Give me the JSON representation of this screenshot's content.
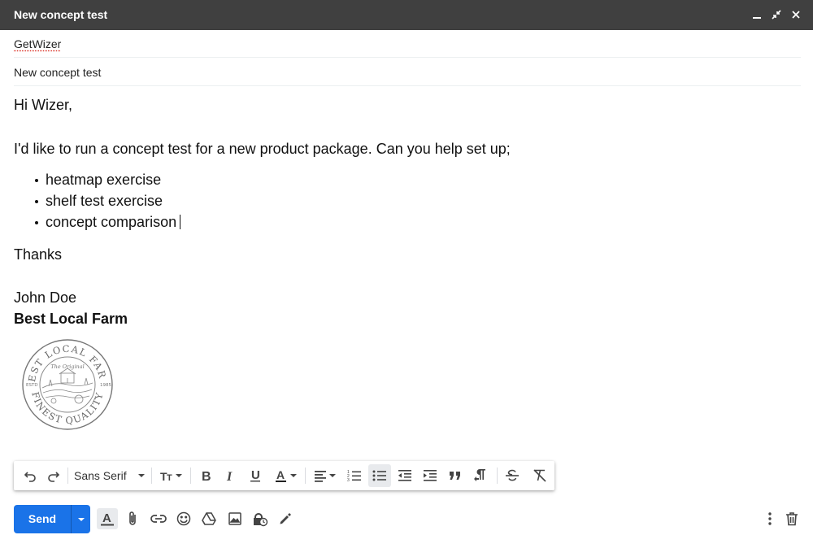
{
  "window": {
    "title": "New concept test",
    "controls": [
      "minimize-icon",
      "exit-fullscreen-icon",
      "close-icon"
    ]
  },
  "header": {
    "to": "GetWizer",
    "subject": "New concept test"
  },
  "message": {
    "greeting": "Hi Wizer,",
    "intro": "I'd like to run a concept test for a new product package. Can you help set up;",
    "items": [
      "heatmap exercise",
      "shelf test exercise",
      "concept comparison"
    ],
    "closing": "Thanks",
    "signature_name": "John Doe",
    "signature_company": "Best Local Farm",
    "logo": {
      "top_text": "BEST LOCAL FARM",
      "bottom_text": "FINEST QUALITY",
      "center_text": "The Original",
      "left_text": "ESTD",
      "right_text": "1985"
    }
  },
  "format_toolbar": {
    "font_family": "Sans Serif",
    "tools": [
      "undo-icon",
      "redo-icon",
      "font-size-icon",
      "bold-icon",
      "italic-icon",
      "underline-icon",
      "text-color-icon",
      "align-icon",
      "numbered-list-icon",
      "bulleted-list-icon",
      "indent-less-icon",
      "indent-more-icon",
      "quote-icon",
      "text-direction-icon",
      "strikethrough-icon",
      "remove-formatting-icon"
    ],
    "active_tool": "bulleted-list-icon"
  },
  "bottom_toolbar": {
    "send_label": "Send",
    "tools": [
      "formatting-options-icon",
      "attach-icon",
      "link-icon",
      "emoji-icon",
      "drive-icon",
      "photo-icon",
      "confidential-mode-icon",
      "signature-icon",
      "more-options-icon",
      "discard-icon"
    ]
  },
  "colors": {
    "titlebar": "#404040",
    "send_button": "#1a73e8",
    "active_tool_bg": "#e8eaed"
  }
}
